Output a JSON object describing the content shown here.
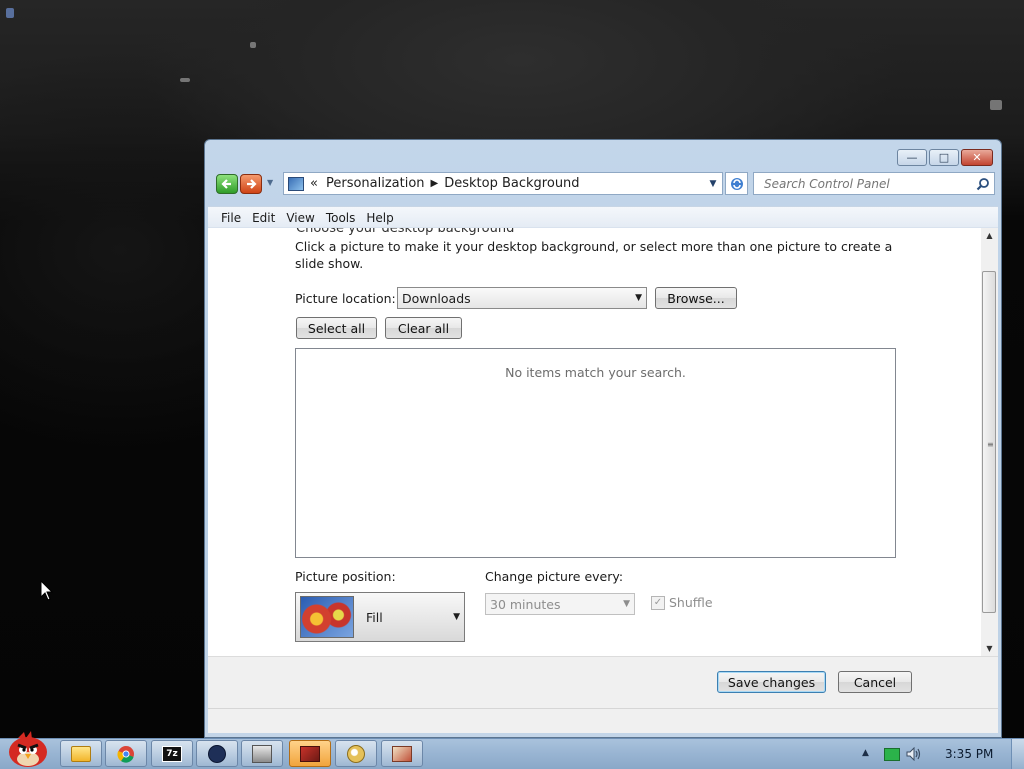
{
  "window": {
    "controls": {
      "minimize": "—",
      "maximize": "□",
      "close": "✕"
    }
  },
  "address": {
    "overflow": "«",
    "crumb1": "Personalization",
    "crumb2": "Desktop Background"
  },
  "search": {
    "placeholder": "Search Control Panel"
  },
  "menu": {
    "items": [
      "File",
      "Edit",
      "View",
      "Tools",
      "Help"
    ]
  },
  "content": {
    "cut_heading": "Choose your desktop background",
    "intro": "Click a picture to make it your desktop background, or select more than one picture to create a slide show.",
    "picture_location_label": "Picture location:",
    "picture_location_value": "Downloads",
    "browse_label": "Browse...",
    "select_all_label": "Select all",
    "clear_all_label": "Clear all",
    "empty_message": "No items match your search.",
    "picture_position_label": "Picture position:",
    "picture_position_value": "Fill",
    "change_every_label": "Change picture every:",
    "change_every_value": "30 minutes",
    "shuffle_label": "Shuffle",
    "shuffle_checked": true
  },
  "footer": {
    "save_label": "Save changes",
    "cancel_label": "Cancel"
  },
  "taskbar": {
    "apps": [
      "explorer-icon",
      "chrome-icon",
      "7zip-icon",
      "app-icon",
      "printer-icon",
      "personalization-icon",
      "paint-icon",
      "app2-icon"
    ],
    "clock": "3:35 PM"
  }
}
